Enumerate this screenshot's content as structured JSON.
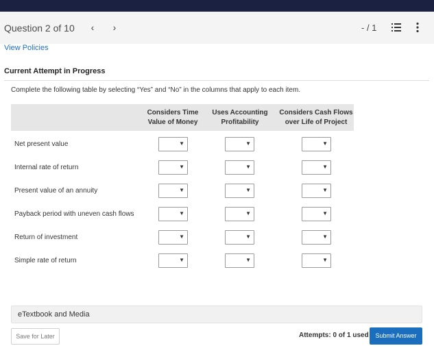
{
  "header": {
    "question_label": "Question 2 of 10",
    "prev_icon": "chevron-left-icon",
    "next_icon": "chevron-right-icon",
    "score": "- / 1",
    "list_icon": "list-icon",
    "more_icon": "more-vertical-icon"
  },
  "links": {
    "view_policies": "View Policies"
  },
  "attempt": {
    "title": "Current Attempt in Progress"
  },
  "question": {
    "instructions": "Complete the following table by selecting “Yes” and “No” in the columns that apply to each item.",
    "columns": [
      {
        "line1": "Considers Time",
        "line2": "Value of Money"
      },
      {
        "line1": "Uses Accounting",
        "line2": "Profitability"
      },
      {
        "line1": "Considers Cash Flows",
        "line2": "over Life of Project"
      }
    ],
    "rows": [
      {
        "label": "Net present value"
      },
      {
        "label": "Internal rate of return"
      },
      {
        "label": "Present value of an annuity"
      },
      {
        "label": "Payback period with uneven cash flows"
      },
      {
        "label": "Return of investment"
      },
      {
        "label": "Simple rate of return"
      }
    ],
    "selected_value": ""
  },
  "etextbook": {
    "label": "eTextbook and Media"
  },
  "footer": {
    "save_label": "Save for Later",
    "attempts_text": "Attempts: 0 of 1 used",
    "submit_label": "Submit Answer"
  },
  "colors": {
    "topbar": "#1b2140",
    "link": "#1a6ebd",
    "submit": "#1a6ebd"
  }
}
